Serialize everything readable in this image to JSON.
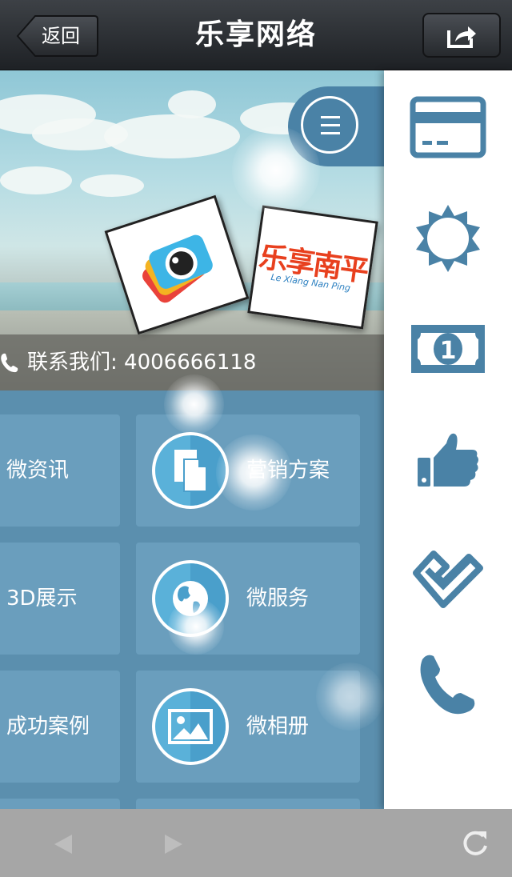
{
  "navbar": {
    "back_label": "返回",
    "title": "乐享网络"
  },
  "banner": {
    "logo_text": "乐享南平",
    "logo_subtext": "Le Xiang Nan Ping",
    "contact_label": "联系我们:",
    "contact_phone": "4006666118"
  },
  "tiles": [
    {
      "label": "微资讯",
      "icon": "info-icon"
    },
    {
      "label": "营销方案",
      "icon": "documents-icon"
    },
    {
      "label": "3D展示",
      "icon": "3d-icon"
    },
    {
      "label": "微服务",
      "icon": "globe-icon"
    },
    {
      "label": "成功案例",
      "icon": "case-icon"
    },
    {
      "label": "微相册",
      "icon": "picture-icon"
    }
  ],
  "side_icons": [
    "card-icon",
    "sun-icon",
    "money-icon",
    "thumbs-up-icon",
    "check-icon",
    "phone-icon"
  ],
  "colors": {
    "accent": "#4a82a6",
    "tile": "#6a9ebd",
    "background": "#5b8fae",
    "toolbar": "#a6a6a6"
  },
  "toolbar": {
    "back_icon": "triangle-left-icon",
    "forward_icon": "triangle-right-icon",
    "reload_icon": "reload-icon"
  }
}
